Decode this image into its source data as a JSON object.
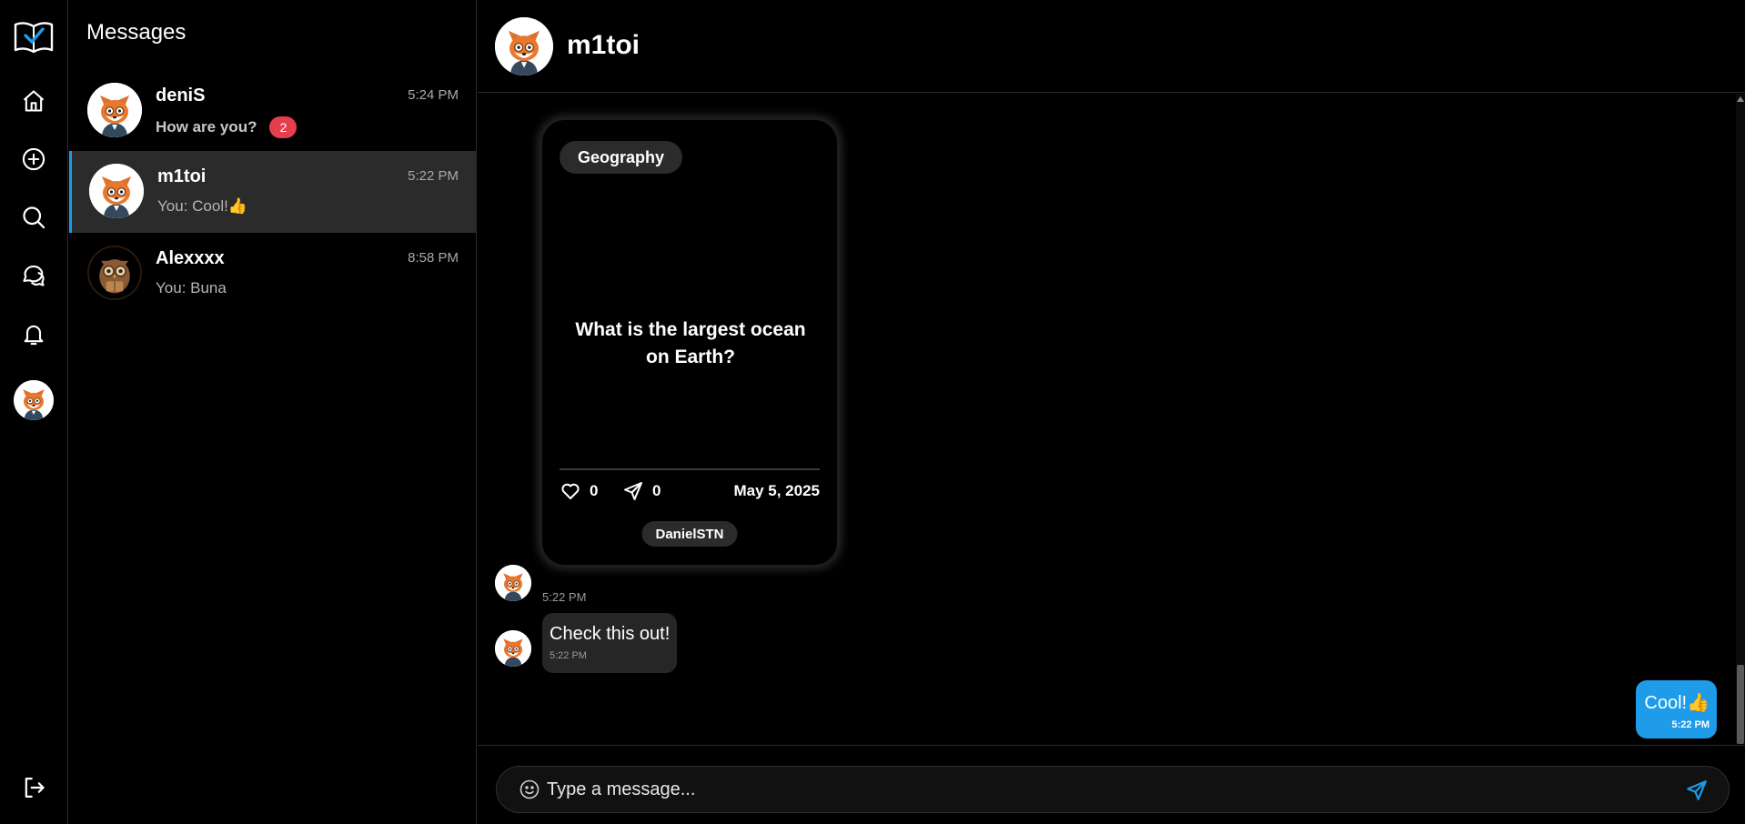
{
  "app": {
    "brand_color": "#1e9be9",
    "badge_color": "#e53e4d"
  },
  "rail": {
    "items": [
      {
        "icon": "logo-book-check-icon"
      },
      {
        "icon": "home-icon"
      },
      {
        "icon": "plus-circle-icon"
      },
      {
        "icon": "search-icon"
      },
      {
        "icon": "chat-bubbles-icon"
      },
      {
        "icon": "bell-icon"
      },
      {
        "icon": "profile-avatar"
      },
      {
        "icon": "logout-icon"
      }
    ]
  },
  "conversations": {
    "title": "Messages",
    "items": [
      {
        "name": "deniS",
        "time": "5:24 PM",
        "preview": "How are you?",
        "unread": "2",
        "avatar": "fox",
        "active": false
      },
      {
        "name": "m1toi",
        "time": "5:22 PM",
        "preview": "You: Cool!👍",
        "avatar": "fox",
        "active": true
      },
      {
        "name": "Alexxxx",
        "time": "8:58 PM",
        "preview": "You: Buna",
        "avatar": "owl",
        "active": false
      }
    ]
  },
  "chat": {
    "title": "m1toi",
    "card": {
      "tag": "Geography",
      "question": "What is the largest ocean on Earth?",
      "likes": "0",
      "shares": "0",
      "date": "May 5, 2025",
      "author": "DanielSTN"
    },
    "card_time": "5:22 PM",
    "incoming": {
      "text": "Check this out!",
      "time": "5:22 PM"
    },
    "outgoing": {
      "text": "Cool!👍",
      "time": "5:22 PM"
    },
    "composer": {
      "placeholder": "Type a message..."
    }
  }
}
